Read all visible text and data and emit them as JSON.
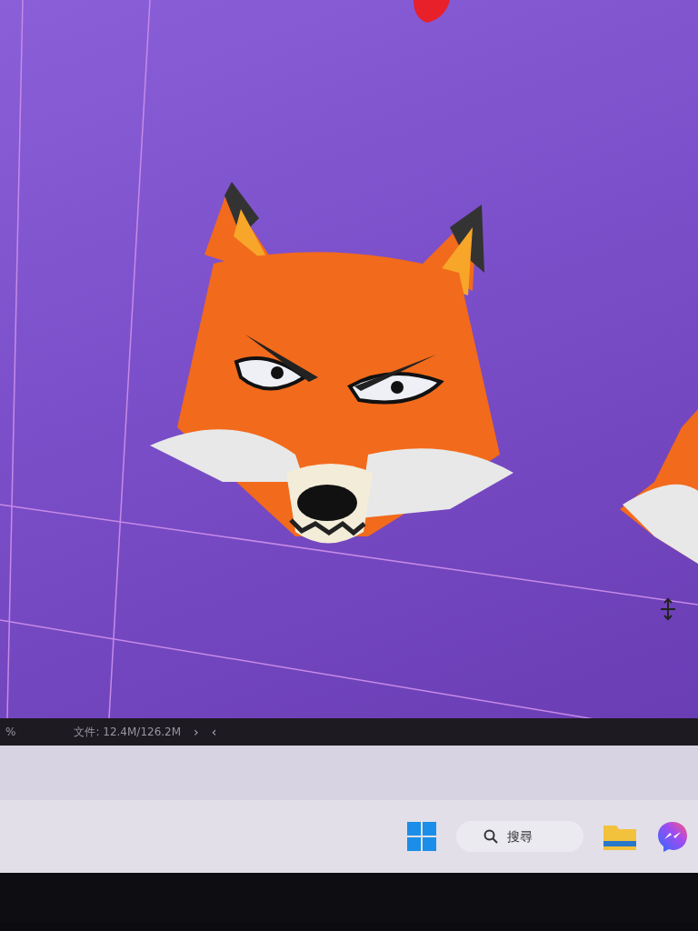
{
  "status_bar": {
    "zoom": "%",
    "file_info": "文件: 12.4M/126.2M",
    "next": "›",
    "prev": "‹"
  },
  "taskbar": {
    "search": {
      "placeholder": "搜尋"
    }
  }
}
